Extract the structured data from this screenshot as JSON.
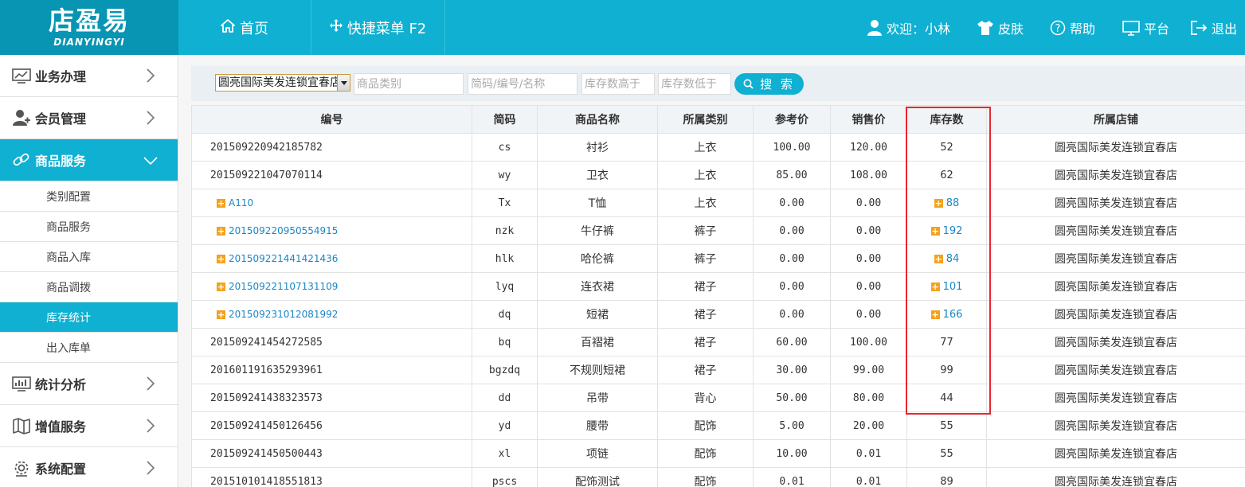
{
  "logo": {
    "cn": "店盈易",
    "en": "DIANYINGYI"
  },
  "topnav": {
    "home": "首页",
    "quick": "快捷菜单 F2"
  },
  "user": {
    "welcome": "欢迎：小林",
    "skin": "皮肤",
    "help": "帮助",
    "platform": "平台",
    "logout": "退出"
  },
  "sidebar": {
    "groups": [
      {
        "label": "业务办理",
        "icon": "monitor-chart-icon"
      },
      {
        "label": "会员管理",
        "icon": "member-icon"
      },
      {
        "label": "商品服务",
        "icon": "link-icon"
      },
      {
        "label": "统计分析",
        "icon": "stats-icon"
      },
      {
        "label": "增值服务",
        "icon": "map-icon"
      },
      {
        "label": "系统配置",
        "icon": "gear-icon"
      }
    ],
    "subitems": [
      "类别配置",
      "商品服务",
      "商品入库",
      "商品调拨",
      "库存统计",
      "出入库单"
    ]
  },
  "search": {
    "store": "圆亮国际美发连锁宜春店",
    "category_ph": "商品类别",
    "code_ph": "简码/编号/名称",
    "above_ph": "库存数高于",
    "below_ph": "库存数低于",
    "button": "搜 索"
  },
  "table": {
    "headers": [
      "编号",
      "简码",
      "商品名称",
      "所属类别",
      "参考价",
      "销售价",
      "库存数",
      "所属店铺"
    ],
    "rows": [
      {
        "code": "201509220942185782",
        "short": "cs",
        "name": "衬衫",
        "cat": "上衣",
        "ref": "100.00",
        "sale": "120.00",
        "stock": "52",
        "store": "圆亮国际美发连锁宜春店"
      },
      {
        "code": "201509221047070114",
        "short": "wy",
        "name": "卫衣",
        "cat": "上衣",
        "ref": "85.00",
        "sale": "108.00",
        "stock": "62",
        "store": "圆亮国际美发连锁宜春店"
      },
      {
        "code": "A110",
        "short": "Tx",
        "name": "T恤",
        "cat": "上衣",
        "ref": "0.00",
        "sale": "0.00",
        "stock": "88",
        "store": "圆亮国际美发连锁宜春店"
      },
      {
        "code": "201509220950554915",
        "short": "nzk",
        "name": "牛仔裤",
        "cat": "裤子",
        "ref": "0.00",
        "sale": "0.00",
        "stock": "192",
        "store": "圆亮国际美发连锁宜春店"
      },
      {
        "code": "201509221441421436",
        "short": "hlk",
        "name": "哈伦裤",
        "cat": "裤子",
        "ref": "0.00",
        "sale": "0.00",
        "stock": "84",
        "store": "圆亮国际美发连锁宜春店"
      },
      {
        "code": "201509221107131109",
        "short": "lyq",
        "name": "连衣裙",
        "cat": "裙子",
        "ref": "0.00",
        "sale": "0.00",
        "stock": "101",
        "store": "圆亮国际美发连锁宜春店"
      },
      {
        "code": "201509231012081992",
        "short": "dq",
        "name": "短裙",
        "cat": "裙子",
        "ref": "0.00",
        "sale": "0.00",
        "stock": "166",
        "store": "圆亮国际美发连锁宜春店"
      },
      {
        "code": "201509241454272585",
        "short": "bq",
        "name": "百褶裙",
        "cat": "裙子",
        "ref": "60.00",
        "sale": "100.00",
        "stock": "77",
        "store": "圆亮国际美发连锁宜春店"
      },
      {
        "code": "201601191635293961",
        "short": "bgzdq",
        "name": "不规则短裙",
        "cat": "裙子",
        "ref": "30.00",
        "sale": "99.00",
        "stock": "99",
        "store": "圆亮国际美发连锁宜春店"
      },
      {
        "code": "201509241438323573",
        "short": "dd",
        "name": "吊带",
        "cat": "背心",
        "ref": "50.00",
        "sale": "80.00",
        "stock": "44",
        "store": "圆亮国际美发连锁宜春店"
      },
      {
        "code": "201509241450126456",
        "short": "yd",
        "name": "腰带",
        "cat": "配饰",
        "ref": "5.00",
        "sale": "20.00",
        "stock": "55",
        "store": "圆亮国际美发连锁宜春店"
      },
      {
        "code": "201509241450500443",
        "short": "xl",
        "name": "项链",
        "cat": "配饰",
        "ref": "10.00",
        "sale": "0.01",
        "stock": "55",
        "store": "圆亮国际美发连锁宜春店"
      },
      {
        "code": "201510101418551813",
        "short": "pscs",
        "name": "配饰测试",
        "cat": "配饰",
        "ref": "0.01",
        "sale": "0.01",
        "stock": "89",
        "store": "圆亮国际美发连锁宜春店"
      }
    ]
  },
  "colors": {
    "primary": "#0fb0d1",
    "logo_bg": "#0795b3",
    "link": "#1a86c6",
    "plus": "#f5a21b",
    "highlight": "#e8262f"
  }
}
